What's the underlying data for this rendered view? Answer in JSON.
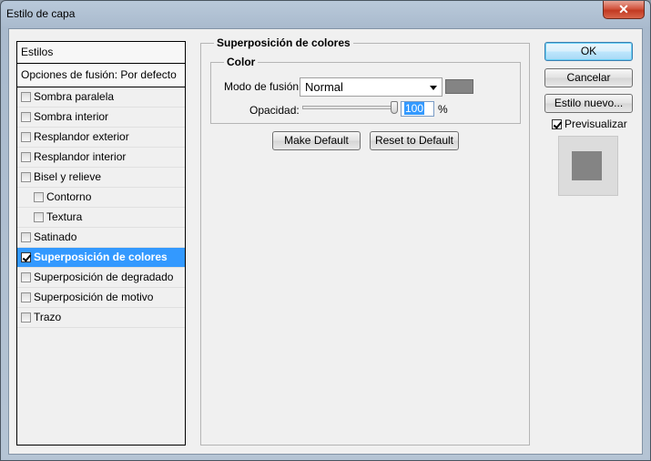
{
  "window": {
    "title": "Estilo de capa",
    "close_glyph": "✕"
  },
  "styles_panel": {
    "header": "Estilos",
    "blending_options": "Opciones de fusión: Por defecto",
    "items": [
      {
        "label": "Sombra paralela",
        "checked": false,
        "indent": false,
        "selected": false
      },
      {
        "label": "Sombra interior",
        "checked": false,
        "indent": false,
        "selected": false
      },
      {
        "label": "Resplandor exterior",
        "checked": false,
        "indent": false,
        "selected": false
      },
      {
        "label": "Resplandor interior",
        "checked": false,
        "indent": false,
        "selected": false
      },
      {
        "label": "Bisel y relieve",
        "checked": false,
        "indent": false,
        "selected": false
      },
      {
        "label": "Contorno",
        "checked": false,
        "indent": true,
        "selected": false
      },
      {
        "label": "Textura",
        "checked": false,
        "indent": true,
        "selected": false
      },
      {
        "label": "Satinado",
        "checked": false,
        "indent": false,
        "selected": false
      },
      {
        "label": "Superposición de colores",
        "checked": true,
        "indent": false,
        "selected": true
      },
      {
        "label": "Superposición de degradado",
        "checked": false,
        "indent": false,
        "selected": false
      },
      {
        "label": "Superposición de motivo",
        "checked": false,
        "indent": false,
        "selected": false
      },
      {
        "label": "Trazo",
        "checked": false,
        "indent": false,
        "selected": false
      }
    ]
  },
  "color_overlay": {
    "section_title": "Superposición de colores",
    "group_title": "Color",
    "blend_mode_label": "Modo de fusión:",
    "blend_mode_value": "Normal",
    "swatch_color": "#848484",
    "opacity_label": "Opacidad:",
    "opacity_value": "100",
    "opacity_fraction": 1.0,
    "opacity_unit": "%",
    "make_default": "Make Default",
    "reset_default": "Reset to Default"
  },
  "actions": {
    "ok": "OK",
    "cancel": "Cancelar",
    "new_style": "Estilo nuevo...",
    "preview_label": "Previsualizar",
    "preview_checked": true,
    "preview_color": "#848484"
  }
}
